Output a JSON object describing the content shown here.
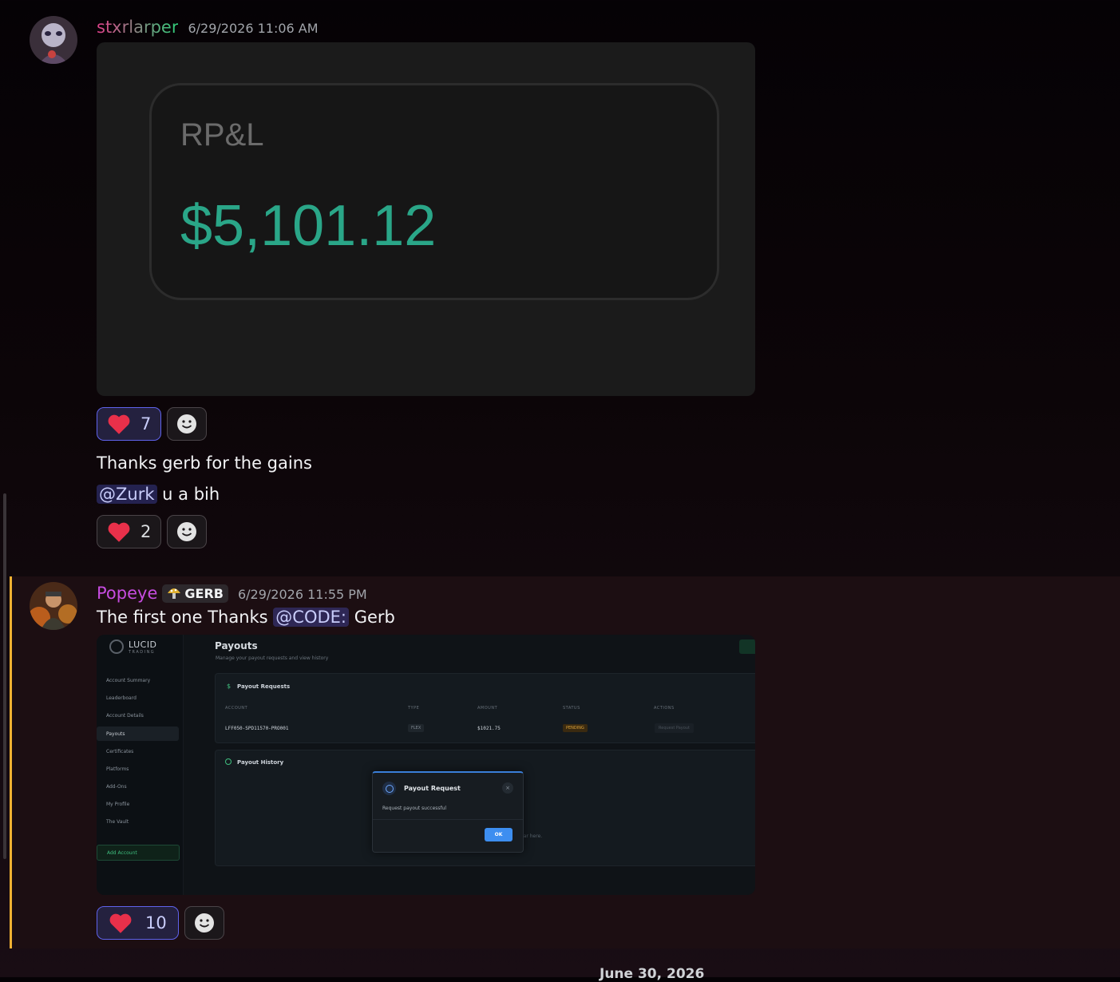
{
  "messages": [
    {
      "username": "stxrlarper",
      "timestamp": "6/29/2026 11:06 AM",
      "attachment": {
        "label": "RP&L",
        "value": "$5,101.12"
      },
      "reactions": [
        {
          "emoji": "heart",
          "count": "7",
          "active": true
        }
      ],
      "lines": [
        {
          "text": "Thanks gerb for the gains"
        },
        {
          "mention": "@Zurk",
          "text": " u a bih"
        }
      ],
      "reactions2": [
        {
          "emoji": "heart",
          "count": "2",
          "active": false
        }
      ]
    },
    {
      "username": "Popeye",
      "badge": "GERB",
      "timestamp": "6/29/2026 11:55 PM",
      "text_pre": "The first one Thanks ",
      "mention": "@CODE:",
      "text_post": " Gerb",
      "attachment": {
        "brand": "LUCID",
        "brand_sub": "TRADING",
        "page_title": "Payouts",
        "page_subtitle": "Manage your payout requests and view history",
        "nav": [
          "Account Summary",
          "Leaderboard",
          "Account Details",
          "Payouts",
          "Certificates",
          "Platforms",
          "Add-Ons",
          "My Profile",
          "The Vault"
        ],
        "add_account": "Add Account",
        "requests_title": "Payout Requests",
        "columns": [
          "ACCOUNT",
          "TYPE",
          "AMOUNT",
          "STATUS",
          "ACTIONS"
        ],
        "row": {
          "account": "LFF050-SPD11570-PRO001",
          "type": "FLEX",
          "amount": "$1021.75",
          "status": "PENDING",
          "action": "Request Payout"
        },
        "history_title": "Payout History",
        "history_empty": "ear here.",
        "dialog": {
          "title": "Payout Request",
          "message": "Request payout successful",
          "ok": "OK"
        }
      },
      "reactions": [
        {
          "emoji": "heart",
          "count": "10",
          "active": true
        }
      ]
    }
  ],
  "date_divider": "June 30, 2026",
  "colors": {
    "accent": "#5865f2",
    "highlight_bar": "#f0b132",
    "positive": "#2aa688"
  }
}
